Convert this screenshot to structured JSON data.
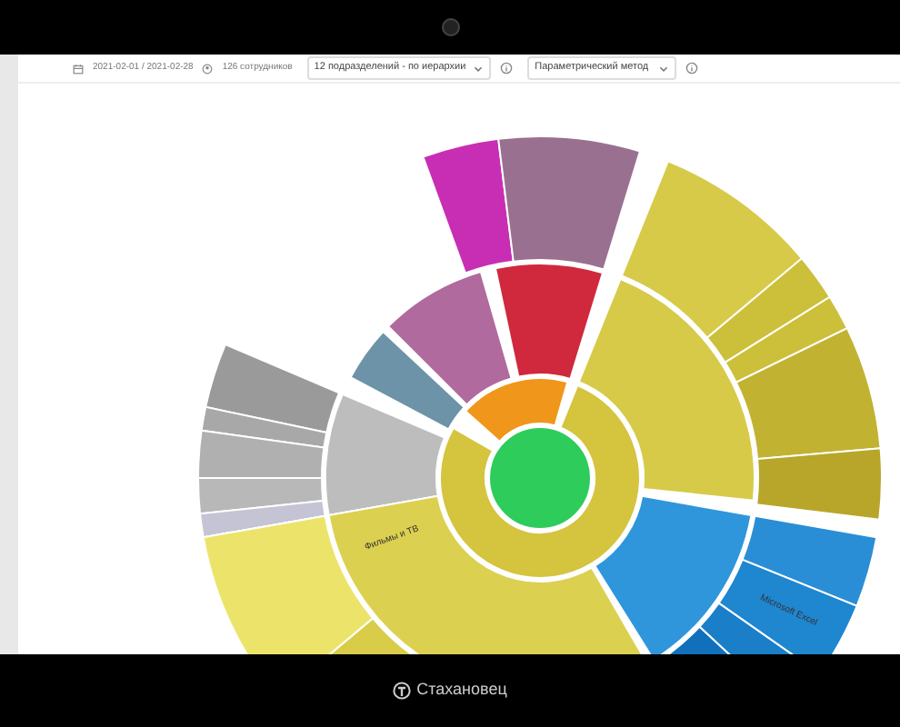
{
  "toolbar": {
    "date_range": "2021-02-01 / 2021-02-28",
    "employees": "126 сотрудников",
    "department_select": "12 подразделений - по иерархии",
    "method_select": "Параметрический метод"
  },
  "chart": {
    "labels": [
      "Фильмы и ТВ",
      "Microsoft Excel"
    ]
  },
  "brand": "Стахановец"
}
